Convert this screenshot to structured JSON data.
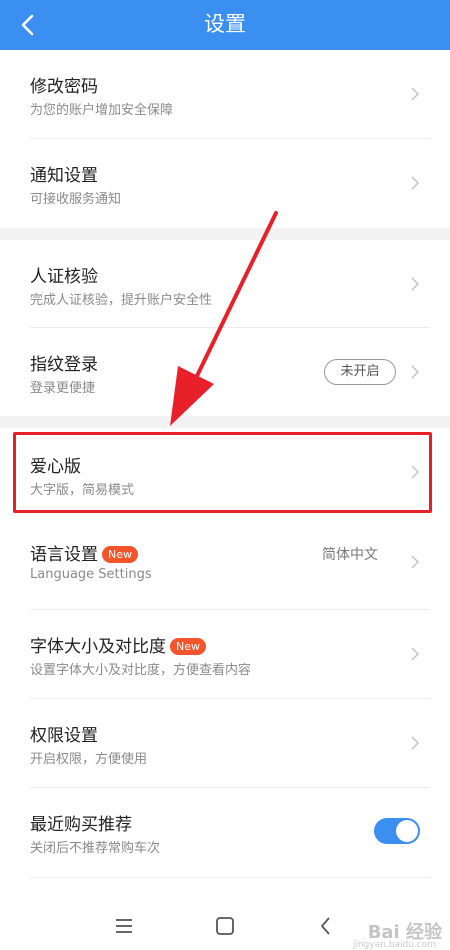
{
  "header": {
    "title": "设置"
  },
  "colors": {
    "header_bg": "#3b8ff0",
    "badge_bg": "#f2552c",
    "highlight": "#e8202a",
    "toggle_on": "#3b8ff0"
  },
  "rows": {
    "change_password": {
      "name": "修改密码",
      "desc": "为您的账户增加安全保障"
    },
    "notifications": {
      "name": "通知设置",
      "desc": "可接收服务通知"
    },
    "identity": {
      "name": "人证核验",
      "desc": "完成人证核验，提升账户安全性"
    },
    "fingerprint": {
      "name": "指纹登录",
      "desc": "登录更便捷",
      "status": "未开启"
    },
    "care_mode": {
      "name": "爱心版",
      "desc": "大字版，简易模式"
    },
    "language": {
      "name": "语言设置",
      "badge": "New",
      "desc": "Language Settings",
      "value": "简体中文"
    },
    "font_size": {
      "name": "字体大小及对比度",
      "badge": "New",
      "desc": "设置字体大小及对比度，方便查看内容"
    },
    "permissions": {
      "name": "权限设置",
      "desc": "开启权限，方便使用"
    },
    "recent_purchase": {
      "name": "最近购买推荐",
      "desc": "关闭后不推荐常购车次",
      "toggle": true
    }
  },
  "icons": {
    "back": "chevron-left-icon",
    "row_arrow": "chevron-right-icon",
    "nav_menu": "menu-icon",
    "nav_home": "home-square-icon",
    "nav_back": "back-triangle-icon"
  },
  "watermark": {
    "text": "Bai 经验",
    "sub": "jingyan.baidu.com"
  }
}
